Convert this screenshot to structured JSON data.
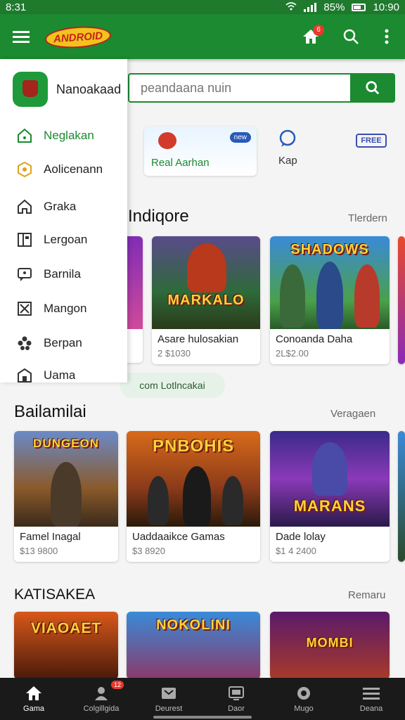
{
  "status": {
    "time": "8:31",
    "battery": "85%",
    "clock": "10:90"
  },
  "topbar": {
    "logo": "ANDROID",
    "notif_count": "6"
  },
  "search": {
    "placeholder": "peandaana nuin"
  },
  "featured": {
    "banner": {
      "label": "Real Aarhan",
      "bubble": "new"
    },
    "chips": [
      {
        "label": "Kap"
      },
      {
        "label": "",
        "badge": "FREE"
      }
    ]
  },
  "sections": [
    {
      "title": "Indiqore",
      "link": "Tlerdern",
      "items": [
        {
          "name": "Asare hulosakian",
          "price": "2 $1030",
          "art": "MARKALO"
        },
        {
          "name": "Conoanda Daha",
          "price": "2L$2.00",
          "art": "SHADOWS"
        }
      ],
      "more": "com Lotlncakai"
    },
    {
      "title": "Bailamilai",
      "link": "Veragaen",
      "items": [
        {
          "name": "Famel Inagal",
          "price": "$13 9800",
          "art": "DUNGEON"
        },
        {
          "name": "Uaddaaikce Gamas",
          "price": "$3 8920",
          "art": "PNBOHIS"
        },
        {
          "name": "Dade lolay",
          "price": "$1 4 2400",
          "art": "MARANS"
        }
      ]
    },
    {
      "title": "KATISAKEA",
      "link": "Remaru",
      "items": [
        {
          "name": "",
          "price": "",
          "art": "VIAOAET"
        },
        {
          "name": "",
          "price": "",
          "art": "NOKOLINI"
        },
        {
          "name": "",
          "price": "",
          "art": "MOMBI"
        }
      ]
    }
  ],
  "drawer": {
    "app_name": "Nanoakaad",
    "items": [
      {
        "label": "Neglakan",
        "icon": "home-outline-icon"
      },
      {
        "label": "Aolicenann",
        "icon": "target-icon"
      },
      {
        "label": "Graka",
        "icon": "house-icon"
      },
      {
        "label": "Lergoan",
        "icon": "book-icon"
      },
      {
        "label": "Barnila",
        "icon": "message-icon"
      },
      {
        "label": "Mangon",
        "icon": "box-x-icon"
      },
      {
        "label": "Berpan",
        "icon": "cluster-icon"
      },
      {
        "label": "Uama",
        "icon": "shop-icon"
      }
    ]
  },
  "bottom_nav": [
    {
      "label": "Gama",
      "icon": "home-icon"
    },
    {
      "label": "Colgillgida",
      "icon": "user-icon",
      "badge": "12"
    },
    {
      "label": "Deurest",
      "icon": "card-icon"
    },
    {
      "label": "Daor",
      "icon": "tv-icon"
    },
    {
      "label": "Mugo",
      "icon": "gear-icon"
    },
    {
      "label": "Deana",
      "icon": "menu-icon"
    }
  ],
  "colors": {
    "accent": "#1b8a30",
    "dark_nav": "#1a1a1a",
    "badge": "#e8392c"
  }
}
